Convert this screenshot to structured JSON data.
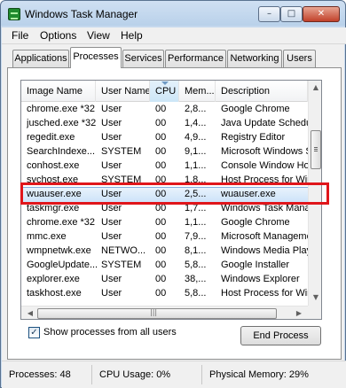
{
  "window": {
    "title": "Windows Task Manager"
  },
  "controls": {
    "minimize": "–",
    "maximize": "□",
    "close": "✕"
  },
  "menu": [
    "File",
    "Options",
    "View",
    "Help"
  ],
  "tabs": [
    "Applications",
    "Processes",
    "Services",
    "Performance",
    "Networking",
    "Users"
  ],
  "active_tab": "Processes",
  "columns": [
    "Image Name",
    "User Name",
    "CPU",
    "Mem...",
    "Description"
  ],
  "sorted_column": "CPU",
  "rows": [
    [
      "chrome.exe *32",
      "User",
      "00",
      "2,8...",
      "Google Chrome"
    ],
    [
      "jusched.exe *32",
      "User",
      "00",
      "1,4...",
      "Java Update Scheduler"
    ],
    [
      "regedit.exe",
      "User",
      "00",
      "4,9...",
      "Registry Editor"
    ],
    [
      "SearchIndexe...",
      "SYSTEM",
      "00",
      "9,1...",
      "Microsoft Windows Search"
    ],
    [
      "conhost.exe",
      "User",
      "00",
      "1,1...",
      "Console Window Host"
    ],
    [
      "svchost.exe",
      "SYSTEM",
      "00",
      "1,8...",
      "Host Process for Windows"
    ],
    [
      "wuauser.exe",
      "User",
      "00",
      "2,5...",
      "wuauser.exe"
    ],
    [
      "taskmgr.exe",
      "User",
      "00",
      "1,7...",
      "Windows Task Manager"
    ],
    [
      "chrome.exe *32",
      "User",
      "00",
      "1,1...",
      "Google Chrome"
    ],
    [
      "mmc.exe",
      "User",
      "00",
      "7,9...",
      "Microsoft Management Console"
    ],
    [
      "wmpnetwk.exe",
      "NETWO...",
      "00",
      "8,1...",
      "Windows Media Player"
    ],
    [
      "GoogleUpdate...",
      "SYSTEM",
      "00",
      "5,8...",
      "Google Installer"
    ],
    [
      "explorer.exe",
      "User",
      "00",
      "38,...",
      "Windows Explorer"
    ],
    [
      "taskhost.exe",
      "User",
      "00",
      "5,8...",
      "Host Process for Windows"
    ]
  ],
  "selected_row": "wuauser.exe",
  "scroll_icons": {
    "up": "▲",
    "down": "▼",
    "left": "◀",
    "right": "▶",
    "grip": "|||"
  },
  "checkbox": {
    "label": "Show processes from all users",
    "checked": true,
    "mark": "✓"
  },
  "end_process_button": "End Process",
  "status": {
    "processes": "Processes: 48",
    "cpu": "CPU Usage: 0%",
    "memory": "Physical Memory: 29%"
  },
  "colors": {
    "highlight_box": "#e0161b",
    "selection": "#cde3f9",
    "title_bar": "#b9d1ea"
  }
}
